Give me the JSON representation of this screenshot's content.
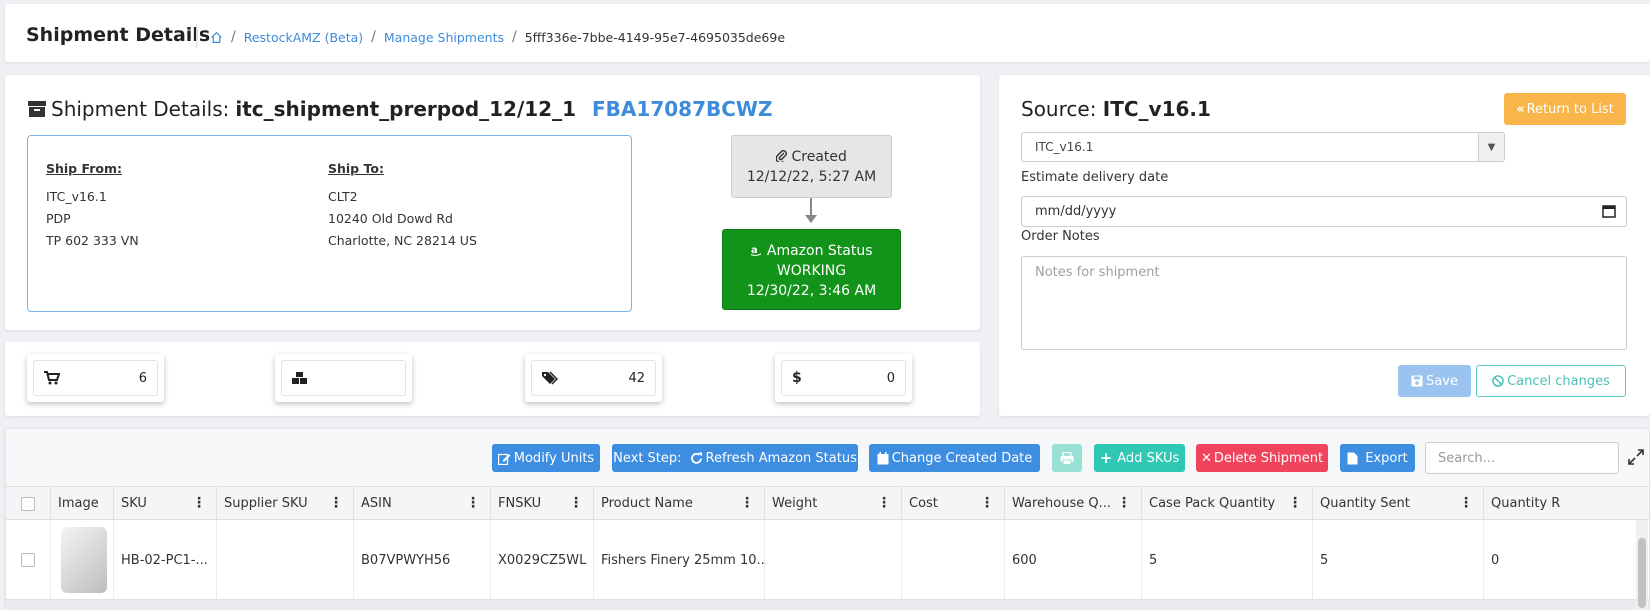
{
  "header": {
    "title": "Shipment Details",
    "breadcrumb": [
      "RestockAMZ (Beta)",
      "Manage Shipments",
      "5fff336e-7bbe-4149-95e7-4695035de69e"
    ]
  },
  "details": {
    "label": "Shipment Details:",
    "name": "itc_shipment_prerpod_12/12_1",
    "fba_id": "FBA17087BCWZ",
    "ship_from": {
      "heading": "Ship From:",
      "line1": "ITC_v16.1",
      "line2": "PDP",
      "line3": "TP 602 333 VN"
    },
    "ship_to": {
      "heading": "Ship To:",
      "line1": "CLT2",
      "line2": "10240 Old Dowd Rd",
      "line3": "Charlotte, NC 28214 US"
    },
    "created": {
      "label": "Created",
      "date": "12/12/22, 5:27 AM"
    },
    "amazon": {
      "label": "Amazon Status",
      "status": "WORKING",
      "date": "12/30/22, 3:46 AM"
    }
  },
  "stats": [
    {
      "icon": "cart-icon",
      "value": "6"
    },
    {
      "icon": "boxes-icon",
      "value": ""
    },
    {
      "icon": "tags-icon",
      "value": "42"
    },
    {
      "icon": "dollar-icon",
      "value": "0"
    }
  ],
  "source": {
    "label": "Source:",
    "name": "ITC_v16.1",
    "return_label": "Return to List",
    "select_value": "ITC_v16.1",
    "delivery_label": "Estimate delivery date",
    "date_placeholder": "mm/dd/yyyy",
    "notes_label": "Order Notes",
    "notes_placeholder": "Notes for shipment",
    "save_label": "Save",
    "cancel_label": "Cancel changes"
  },
  "toolbar": {
    "modify": "Modify Units",
    "next_step": "Next Step:",
    "refresh": "Refresh Amazon Status",
    "change_date": "Change Created Date",
    "add_skus": "Add SKUs",
    "delete": "Delete Shipment",
    "export": "Export",
    "search_placeholder": "Search..."
  },
  "table": {
    "columns": [
      "Image",
      "SKU",
      "Supplier SKU",
      "ASIN",
      "FNSKU",
      "Product Name",
      "Weight",
      "Cost",
      "Warehouse Q...",
      "Case Pack Quantity",
      "Quantity Sent",
      "Quantity R"
    ],
    "rows": [
      [
        "",
        "HB-02-PC1-...",
        "",
        "B07VPWYH56",
        "X0029CZ5WL",
        "Fishers Finery 25mm 10...",
        "",
        "",
        "600",
        "5",
        "5",
        "0"
      ]
    ]
  },
  "colors": {
    "accent": "#3d8de1",
    "success": "#12931a",
    "warning": "#f7b54a",
    "danger": "#f0445d",
    "teal": "#2ec8b4"
  }
}
